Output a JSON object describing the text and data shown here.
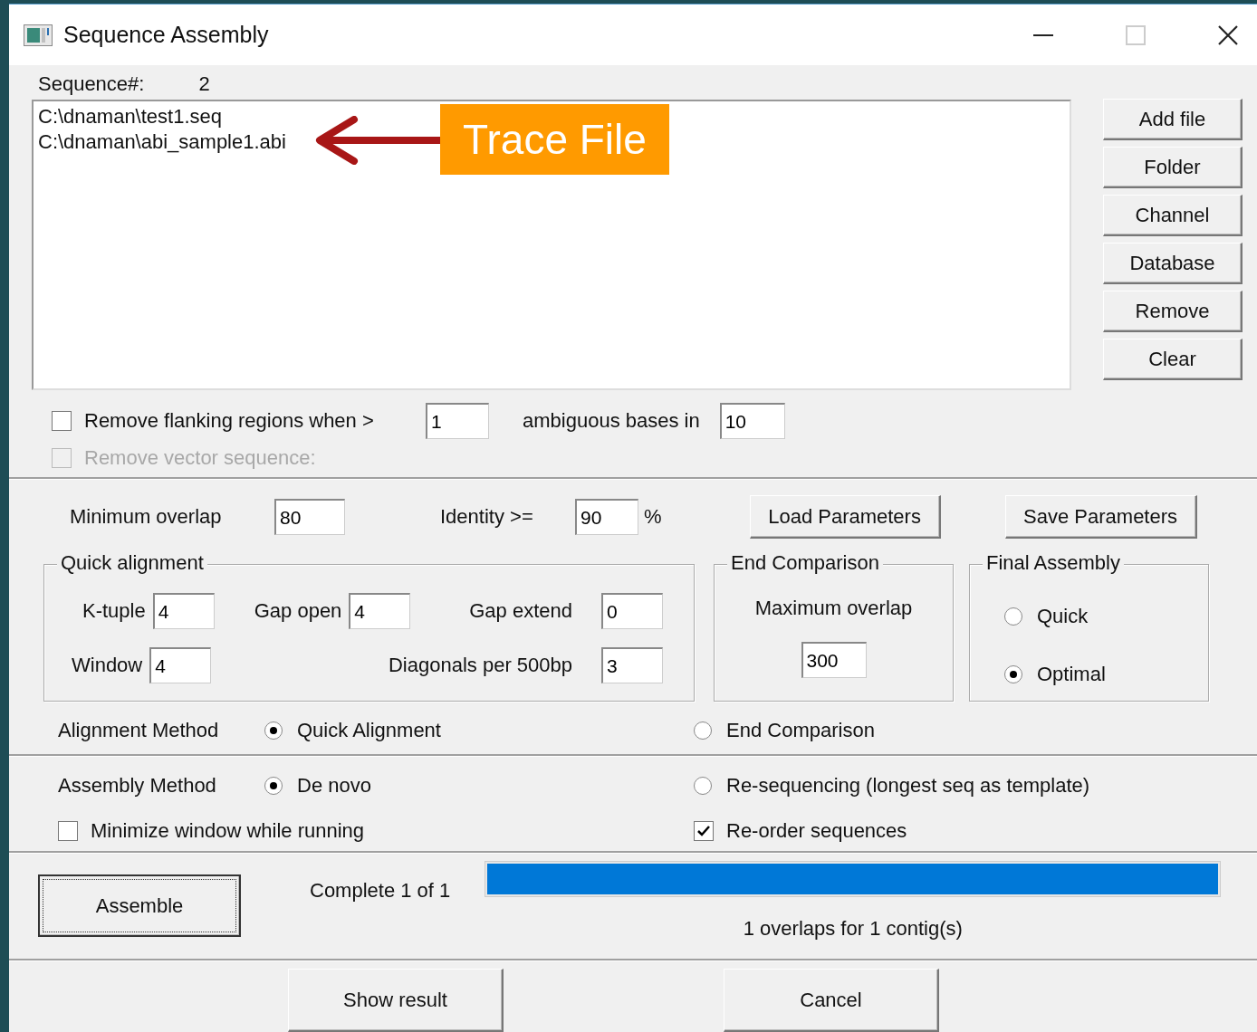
{
  "window": {
    "title": "Sequence Assembly"
  },
  "sequence_count": {
    "label": "Sequence#:",
    "value": "2"
  },
  "files": [
    {
      "path": "C:\\dnaman\\test1.seq"
    },
    {
      "path": "C:\\dnaman\\abi_sample1.abi"
    }
  ],
  "callout": {
    "label": "Trace File"
  },
  "side_buttons": [
    "Add file",
    "Folder",
    "Channel",
    "Database",
    "Remove",
    "Clear"
  ],
  "flanking": {
    "label": "Remove flanking regions when >",
    "checked": false,
    "value": "1",
    "middle_label": "ambiguous bases in",
    "value2": "10"
  },
  "vector": {
    "label": "Remove vector sequence:",
    "checked": false,
    "disabled": true
  },
  "minimum_overlap": {
    "label": "Minimum overlap",
    "value": "80"
  },
  "identity": {
    "label": "Identity >=",
    "value": "90",
    "unit": "%"
  },
  "param_buttons": [
    "Load Parameters",
    "Save Parameters"
  ],
  "quick_alignment": {
    "title": "Quick alignment",
    "rows": [
      {
        "fields": [
          {
            "label": "K-tuple",
            "value": "4"
          },
          {
            "label": "Gap open",
            "value": "4"
          },
          {
            "label": "Gap extend",
            "value": "0"
          }
        ]
      },
      {
        "fields": [
          {
            "label": "Window",
            "value": "4"
          },
          {
            "label": "Diagonals per 500bp",
            "value": "3"
          }
        ]
      }
    ]
  },
  "end_comparison": {
    "title": "End Comparison",
    "label": "Maximum overlap",
    "value": "300"
  },
  "final_assembly": {
    "title": "Final Assembly",
    "options": [
      {
        "label": "Quick",
        "selected": false
      },
      {
        "label": "Optimal",
        "selected": true
      }
    ]
  },
  "alignment_method": {
    "label": "Alignment Method",
    "options": [
      {
        "label": "Quick Alignment",
        "selected": true
      },
      {
        "label": "End Comparison",
        "selected": false
      }
    ]
  },
  "assembly_method": {
    "label": "Assembly Method",
    "options": [
      {
        "label": "De novo",
        "selected": true
      },
      {
        "label": "Re-sequencing (longest seq as template)",
        "selected": false
      }
    ]
  },
  "minimize": {
    "label": "Minimize window while running",
    "checked": false
  },
  "reorder": {
    "label": "Re-order sequences",
    "checked": true
  },
  "assemble_button": "Assemble",
  "progress": {
    "label": "Complete 1 of 1",
    "level": 1.0,
    "status": "1 overlaps for 1 contig(s)"
  },
  "bottom_buttons": [
    "Show result",
    "Cancel"
  ]
}
